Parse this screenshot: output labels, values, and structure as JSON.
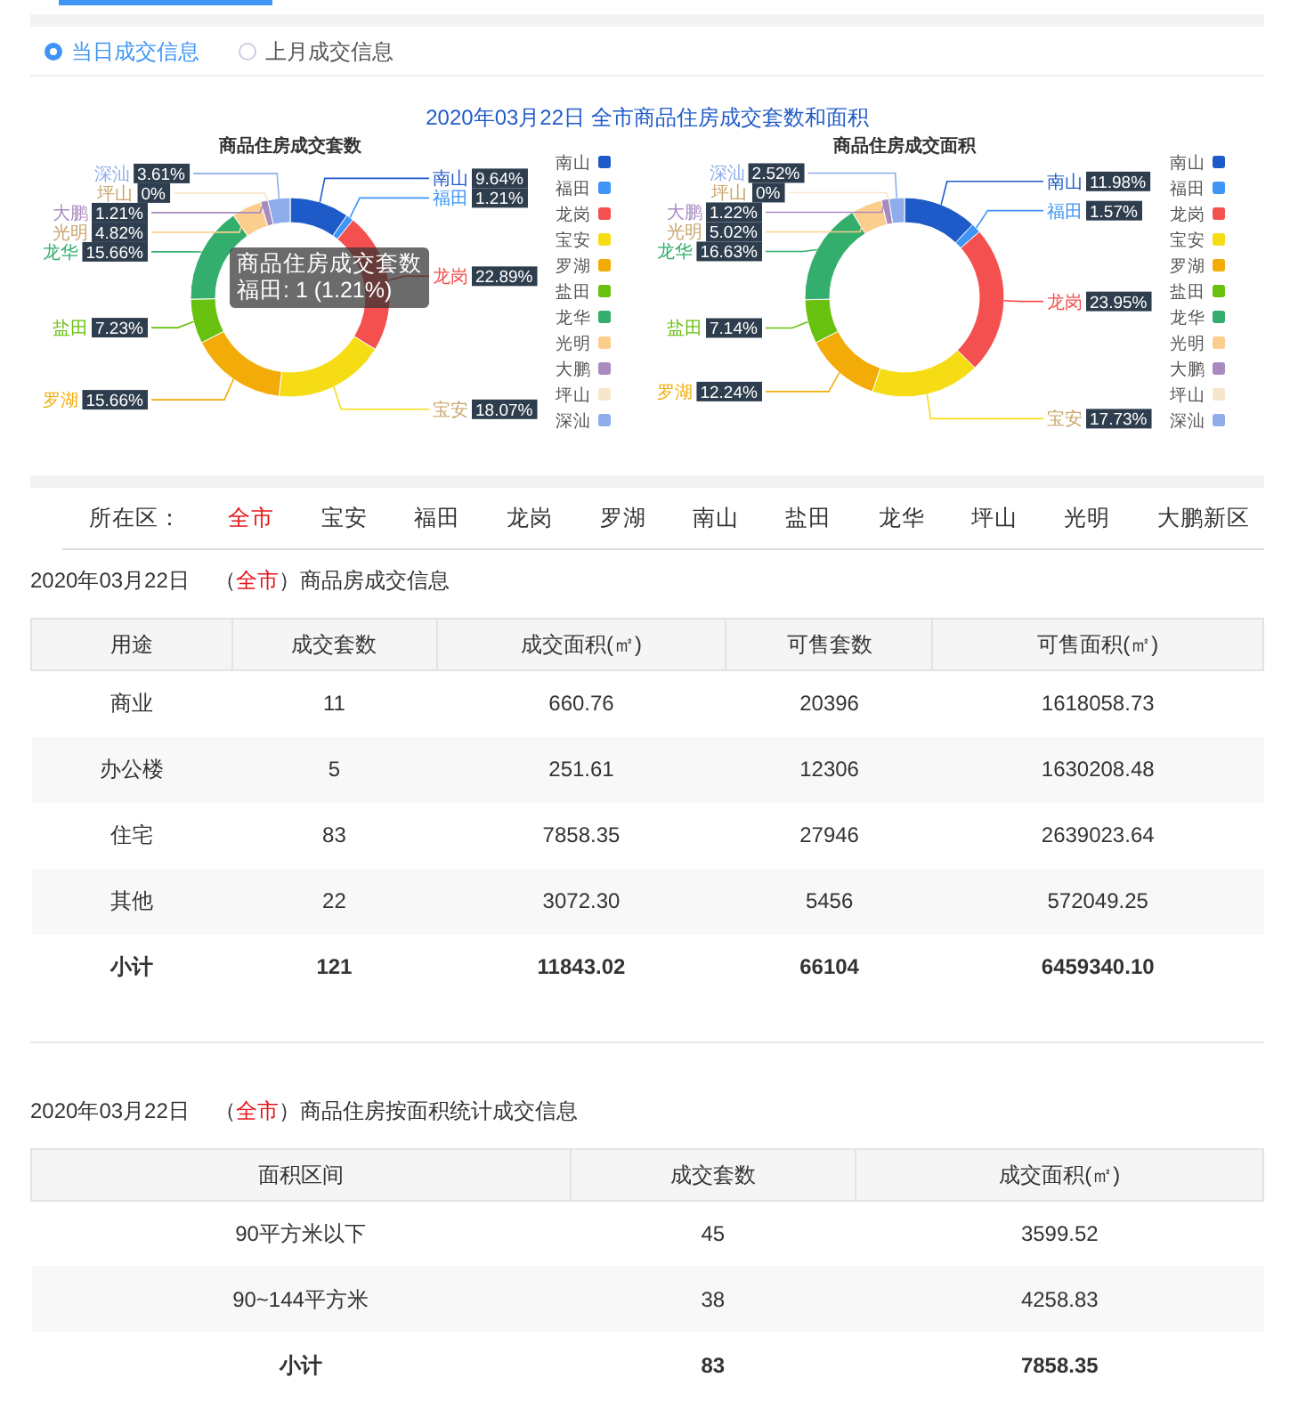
{
  "radio_options": [
    {
      "label": "当日成交信息",
      "selected": true
    },
    {
      "label": "上月成交信息",
      "selected": false
    }
  ],
  "chart_heading": "2020年03月22日 全市商品住房成交套数和面积",
  "charts": [
    {
      "chart_data": {
        "type": "donut",
        "title": "商品住房成交套数",
        "categories": [
          "南山",
          "福田",
          "龙岗",
          "宝安",
          "罗湖",
          "盐田",
          "龙华",
          "光明",
          "大鹏",
          "坪山",
          "深汕"
        ],
        "values": [
          9.64,
          1.21,
          22.89,
          18.07,
          15.66,
          7.23,
          15.66,
          4.82,
          1.21,
          0,
          3.61
        ],
        "value_labels": [
          "9.64%",
          "1.21%",
          "22.89%",
          "18.07%",
          "15.66%",
          "7.23%",
          "15.66%",
          "4.82%",
          "1.21%",
          "0%",
          "3.61%"
        ]
      },
      "legend": [
        {
          "label": "南山",
          "color": "#1f5bc8"
        },
        {
          "label": "福田",
          "color": "#3e95f5"
        },
        {
          "label": "龙岗",
          "color": "#f4504f"
        },
        {
          "label": "宝安",
          "color": "#f5dc15"
        },
        {
          "label": "罗湖",
          "color": "#f3ac07"
        },
        {
          "label": "盐田",
          "color": "#67c10e"
        },
        {
          "label": "龙华",
          "color": "#33ae6c"
        },
        {
          "label": "光明",
          "color": "#fcce8e"
        },
        {
          "label": "大鹏",
          "color": "#a98bc0"
        },
        {
          "label": "坪山",
          "color": "#f8e6cc"
        },
        {
          "label": "深汕",
          "color": "#8fadea"
        }
      ],
      "tooltip": {
        "title": "商品住房成交套数",
        "text": "福田: 1 (1.21%)"
      }
    },
    {
      "chart_data": {
        "type": "donut",
        "title": "商品住房成交面积",
        "categories": [
          "南山",
          "福田",
          "龙岗",
          "宝安",
          "罗湖",
          "盐田",
          "龙华",
          "光明",
          "大鹏",
          "坪山",
          "深汕"
        ],
        "values": [
          11.98,
          1.57,
          23.95,
          17.73,
          12.24,
          7.14,
          16.63,
          5.02,
          1.22,
          0,
          2.52
        ],
        "value_labels": [
          "11.98%",
          "1.57%",
          "23.95%",
          "17.73%",
          "12.24%",
          "7.14%",
          "16.63%",
          "5.02%",
          "1.22%",
          "0%",
          "2.52%"
        ]
      },
      "legend": [
        {
          "label": "南山",
          "color": "#1f5bc8"
        },
        {
          "label": "福田",
          "color": "#3e95f5"
        },
        {
          "label": "龙岗",
          "color": "#f4504f"
        },
        {
          "label": "宝安",
          "color": "#f5dc15"
        },
        {
          "label": "罗湖",
          "color": "#f3ac07"
        },
        {
          "label": "盐田",
          "color": "#67c10e"
        },
        {
          "label": "龙华",
          "color": "#33ae6c"
        },
        {
          "label": "光明",
          "color": "#fcce8e"
        },
        {
          "label": "大鹏",
          "color": "#a98bc0"
        },
        {
          "label": "坪山",
          "color": "#f8e6cc"
        },
        {
          "label": "深汕",
          "color": "#8fadea"
        }
      ]
    }
  ],
  "district_filter": {
    "label": "所在区：",
    "districts": [
      {
        "label": "全市",
        "selected": true
      },
      {
        "label": "宝安",
        "selected": false
      },
      {
        "label": "福田",
        "selected": false
      },
      {
        "label": "龙岗",
        "selected": false
      },
      {
        "label": "罗湖",
        "selected": false
      },
      {
        "label": "南山",
        "selected": false
      },
      {
        "label": "盐田",
        "selected": false
      },
      {
        "label": "龙华",
        "selected": false
      },
      {
        "label": "坪山",
        "selected": false
      },
      {
        "label": "光明",
        "selected": false
      },
      {
        "label": "大鹏新区",
        "selected": false
      }
    ]
  },
  "tables": [
    {
      "date": "2020年03月22日",
      "open": "（",
      "scope": "全市",
      "close": "）",
      "title": "商品房成交信息",
      "columns": [
        "用途",
        "成交套数",
        "成交面积(㎡)",
        "可售套数",
        "可售面积(㎡)"
      ],
      "rows": [
        {
          "kind": "data",
          "cells": [
            "商业",
            "11",
            "660.76",
            "20396",
            "1618058.73"
          ]
        },
        {
          "kind": "data",
          "cells": [
            "办公楼",
            "5",
            "251.61",
            "12306",
            "1630208.48"
          ]
        },
        {
          "kind": "data",
          "cells": [
            "住宅",
            "83",
            "7858.35",
            "27946",
            "2639023.64"
          ]
        },
        {
          "kind": "data",
          "cells": [
            "其他",
            "22",
            "3072.30",
            "5456",
            "572049.25"
          ]
        },
        {
          "kind": "total",
          "cells": [
            "小计",
            "121",
            "11843.02",
            "66104",
            "6459340.10"
          ]
        }
      ]
    },
    {
      "date": "2020年03月22日",
      "open": "（",
      "scope": "全市",
      "close": "）",
      "title": "商品住房按面积统计成交信息",
      "columns": [
        "面积区间",
        "成交套数",
        "成交面积(㎡)"
      ],
      "rows": [
        {
          "kind": "data",
          "cells": [
            "90平方米以下",
            "45",
            "3599.52"
          ]
        },
        {
          "kind": "data",
          "cells": [
            "90~144平方米",
            "38",
            "4258.83"
          ]
        },
        {
          "kind": "total",
          "cells": [
            "小计",
            "83",
            "7858.35"
          ]
        }
      ]
    }
  ]
}
